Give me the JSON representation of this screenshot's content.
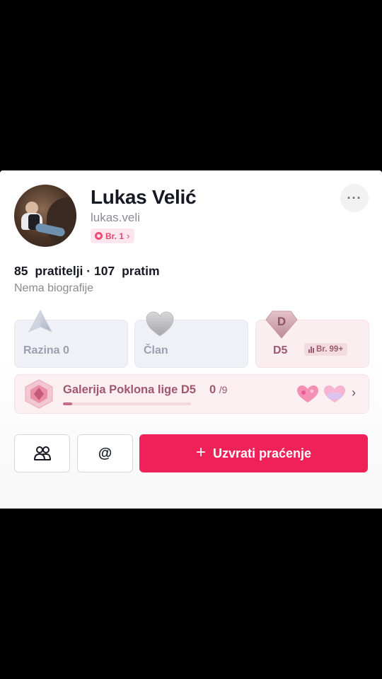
{
  "profile": {
    "name": "Lukas Velić",
    "handle": "lukas.veli",
    "rank_badge": "Br. 1",
    "more_icon": "more-horizontal-icon"
  },
  "stats": {
    "followers_count": "85",
    "followers_label": "pratitelji",
    "separator": " · ",
    "following_count": "107",
    "following_label": "pratim"
  },
  "bio": "Nema biografije",
  "tiles": {
    "level": {
      "label": "Razina 0",
      "icon": "level-plane-icon"
    },
    "member": {
      "label": "Član",
      "icon": "heart-icon"
    },
    "league": {
      "label": "D5",
      "icon": "league-diamond-icon",
      "diamond_letter": "D",
      "rank": "Br. 99+"
    }
  },
  "gallery": {
    "title": "Galerija Poklona lige D5",
    "count": "0",
    "total": "/9",
    "progress": 0.07
  },
  "actions": {
    "friends_icon": "friends-icon",
    "mention_label": "@",
    "follow_back_label": "Uzvrati praćenje",
    "follow_plus": "+"
  },
  "colors": {
    "accent": "#ef2158",
    "league_text": "#a0566e",
    "muted": "#8a8b91"
  }
}
